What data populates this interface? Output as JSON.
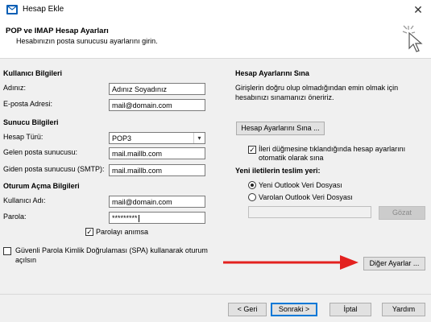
{
  "titlebar": {
    "title": "Hesap Ekle",
    "close_symbol": "✕"
  },
  "header": {
    "heading": "POP ve IMAP Hesap Ayarları",
    "subheading": "Hesabınızın posta sunucusu ayarlarını girin."
  },
  "user_info": {
    "section": "Kullanıcı Bilgileri",
    "name_label": "Adınız:",
    "name_value": "Adınız Soyadınız",
    "email_label": "E-posta Adresi:",
    "email_value": "mail@domain.com"
  },
  "server_info": {
    "section": "Sunucu Bilgileri",
    "account_type_label": "Hesap Türü:",
    "account_type_value": "POP3",
    "incoming_label": "Gelen posta sunucusu:",
    "incoming_value": "mail.maillb.com",
    "outgoing_label": "Giden posta sunucusu (SMTP):",
    "outgoing_value": "mail.maillb.com"
  },
  "login_info": {
    "section": "Oturum Açma Bilgileri",
    "username_label": "Kullanıcı Adı:",
    "username_value": "mail@domain.com",
    "password_label": "Parola:",
    "password_value": "*********",
    "remember_label": "Parolayı anımsa",
    "remember_checked": true,
    "spa_label_line1": "Güvenli Parola Kimlik Doğrulaması (SPA) kullanarak oturum",
    "spa_label_line2": "açılsın",
    "spa_checked": false
  },
  "test_settings": {
    "section": "Hesap Ayarlarını Sına",
    "description_line1": "Girişlerin doğru olup olmadığından emin olmak için",
    "description_line2": "hesabınızı sınamanızı öneririz.",
    "test_button": "Hesap Ayarlarını Sına ...",
    "auto_test_line1": "İleri düğmesine tıklandığında hesap ayarlarını",
    "auto_test_line2": "otomatik olarak sına",
    "auto_test_checked": true
  },
  "delivery": {
    "section": "Yeni iletilerin teslim yeri:",
    "option_new": "Yeni Outlook Veri Dosyası",
    "option_existing": "Varolan Outlook Veri Dosyası",
    "selected": "new",
    "browse_button": "Gözat",
    "path_value": ""
  },
  "more_settings_button": "Diğer Ayarlar ...",
  "footer": {
    "back": "< Geri",
    "next": "Sonraki >",
    "cancel": "İptal",
    "help": "Yardım"
  },
  "colors": {
    "annotation_arrow": "#e3211f",
    "accent": "#0078d7"
  },
  "icons": {
    "app": "outlook-icon",
    "header": "click-cursor-icon",
    "close": "close-icon"
  }
}
